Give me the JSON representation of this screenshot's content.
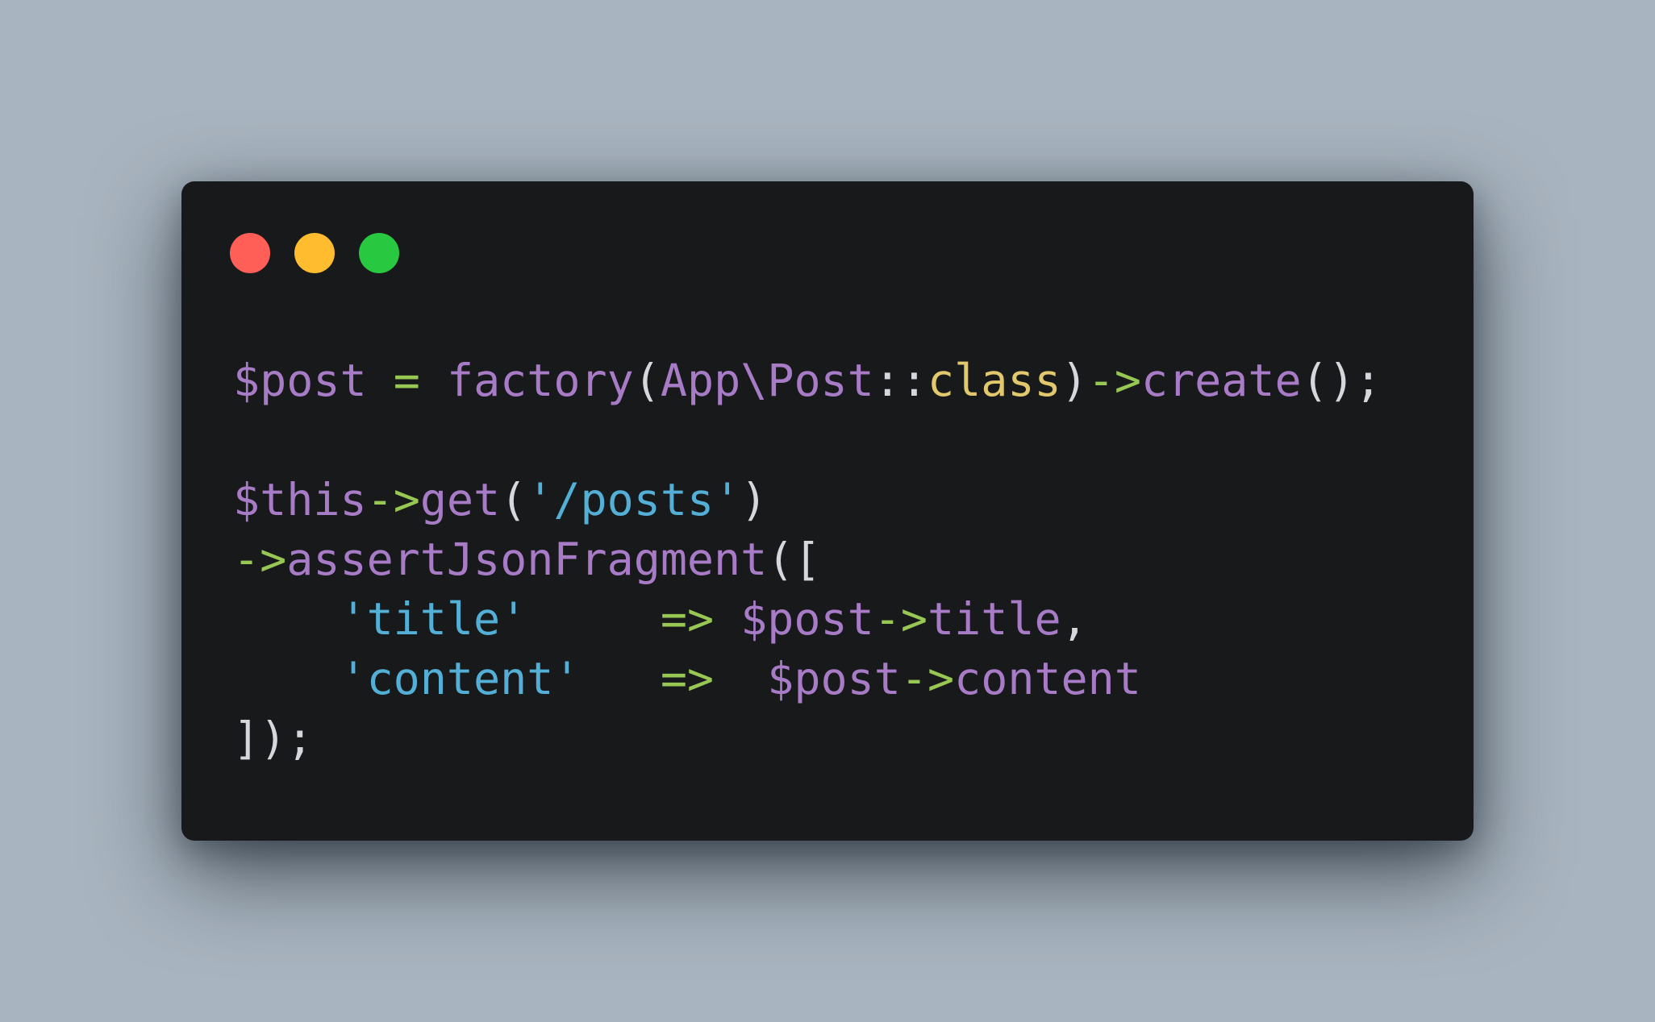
{
  "colors": {
    "background": "#a8b4bf",
    "window": "#18191b",
    "close": "#ff5f57",
    "minimize": "#febc2e",
    "maximize": "#28c840",
    "variable": "#a77bc6",
    "operator": "#98c754",
    "string": "#53afd6",
    "keyword": "#e2c86c",
    "punctuation": "#d4d7dc"
  },
  "window_controls": [
    "close-button",
    "minimize-button",
    "maximize-button"
  ],
  "code_lines": [
    [
      {
        "t": "$post",
        "k": "var"
      },
      {
        "t": " ",
        "k": "punc"
      },
      {
        "t": "=",
        "k": "op"
      },
      {
        "t": " ",
        "k": "punc"
      },
      {
        "t": "factory",
        "k": "fn"
      },
      {
        "t": "(",
        "k": "punc"
      },
      {
        "t": "App\\Post",
        "k": "var"
      },
      {
        "t": "::",
        "k": "punc"
      },
      {
        "t": "class",
        "k": "kw"
      },
      {
        "t": ")",
        "k": "punc"
      },
      {
        "t": "->",
        "k": "op"
      },
      {
        "t": "create",
        "k": "fn"
      },
      {
        "t": "();",
        "k": "punc"
      }
    ],
    [],
    [
      {
        "t": "$this",
        "k": "var"
      },
      {
        "t": "->",
        "k": "op"
      },
      {
        "t": "get",
        "k": "fn"
      },
      {
        "t": "(",
        "k": "punc"
      },
      {
        "t": "'/posts'",
        "k": "str"
      },
      {
        "t": ")",
        "k": "punc"
      }
    ],
    [
      {
        "t": "->",
        "k": "op"
      },
      {
        "t": "assertJsonFragment",
        "k": "fn"
      },
      {
        "t": "([",
        "k": "punc"
      }
    ],
    [
      {
        "t": "    ",
        "k": "punc"
      },
      {
        "t": "'title'",
        "k": "str"
      },
      {
        "t": "     ",
        "k": "punc"
      },
      {
        "t": "=>",
        "k": "op"
      },
      {
        "t": " ",
        "k": "punc"
      },
      {
        "t": "$post",
        "k": "var"
      },
      {
        "t": "->",
        "k": "op"
      },
      {
        "t": "title",
        "k": "fn"
      },
      {
        "t": ",",
        "k": "punc"
      }
    ],
    [
      {
        "t": "    ",
        "k": "punc"
      },
      {
        "t": "'content'",
        "k": "str"
      },
      {
        "t": "   ",
        "k": "punc"
      },
      {
        "t": "=>",
        "k": "op"
      },
      {
        "t": "  ",
        "k": "punc"
      },
      {
        "t": "$post",
        "k": "var"
      },
      {
        "t": "->",
        "k": "op"
      },
      {
        "t": "content",
        "k": "fn"
      }
    ],
    [
      {
        "t": "]);",
        "k": "punc"
      }
    ]
  ]
}
